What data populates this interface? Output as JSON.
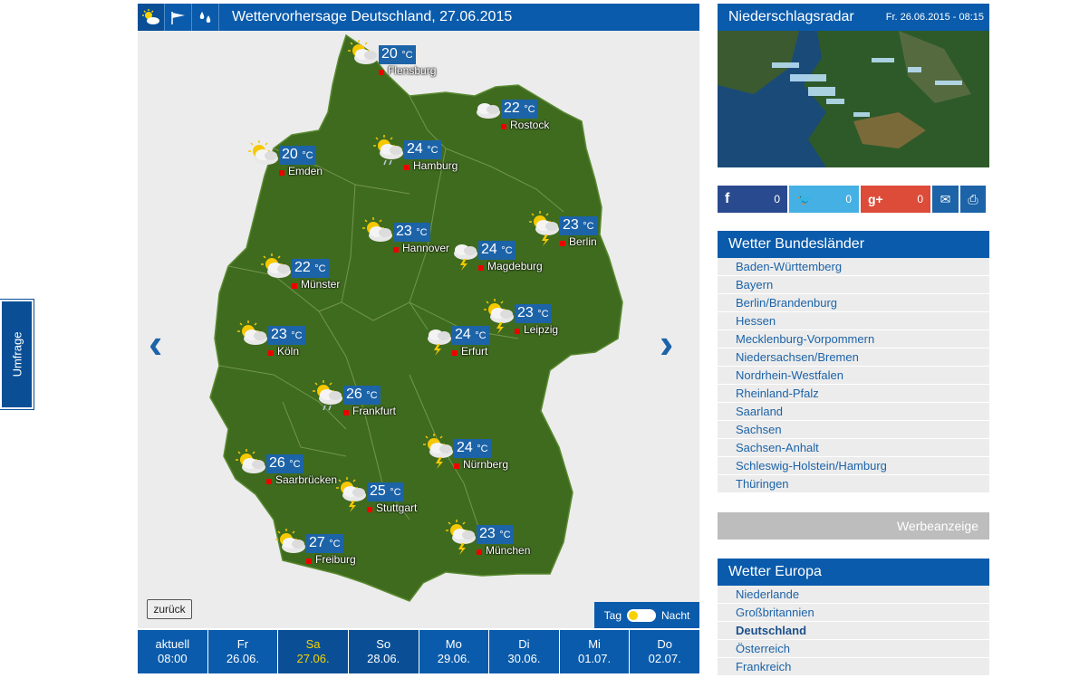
{
  "umfrage": {
    "label": "Umfrage"
  },
  "map": {
    "title": "Wettervorhersage Deutschland, 27.06.2015",
    "header_icons": [
      "sun-cloud-icon",
      "wind-icon",
      "rain-drops-icon"
    ],
    "unit": "°C",
    "cities": [
      {
        "name": "Flensburg",
        "temp": "20",
        "icon": "sun-cloud-icon"
      },
      {
        "name": "Rostock",
        "temp": "22",
        "icon": "cloud-icon"
      },
      {
        "name": "Hamburg",
        "temp": "24",
        "icon": "sun-cloud-rain-icon"
      },
      {
        "name": "Emden",
        "temp": "20",
        "icon": "sun-cloud-icon"
      },
      {
        "name": "Berlin",
        "temp": "23",
        "icon": "sun-cloud-thunder-icon"
      },
      {
        "name": "Hannover",
        "temp": "23",
        "icon": "sun-cloud-icon"
      },
      {
        "name": "Magdeburg",
        "temp": "24",
        "icon": "cloud-thunder-icon"
      },
      {
        "name": "Münster",
        "temp": "22",
        "icon": "sun-cloud-icon"
      },
      {
        "name": "Leipzig",
        "temp": "23",
        "icon": "sun-cloud-thunder-icon"
      },
      {
        "name": "Köln",
        "temp": "23",
        "icon": "sun-cloud-icon"
      },
      {
        "name": "Erfurt",
        "temp": "24",
        "icon": "cloud-thunder-icon"
      },
      {
        "name": "Frankfurt",
        "temp": "26",
        "icon": "sun-cloud-rain-icon"
      },
      {
        "name": "Nürnberg",
        "temp": "24",
        "icon": "sun-cloud-thunder-icon"
      },
      {
        "name": "Saarbrücken",
        "temp": "26",
        "icon": "sun-cloud-icon"
      },
      {
        "name": "Stuttgart",
        "temp": "25",
        "icon": "sun-cloud-thunder-icon"
      },
      {
        "name": "München",
        "temp": "23",
        "icon": "sun-cloud-thunder-icon"
      },
      {
        "name": "Freiburg",
        "temp": "27",
        "icon": "sun-cloud-icon"
      }
    ],
    "back_label": "zurück",
    "toggle": {
      "day": "Tag",
      "night": "Nacht"
    },
    "days": [
      {
        "day": "aktuell",
        "date": "08:00"
      },
      {
        "day": "Fr",
        "date": "26.06."
      },
      {
        "day": "Sa",
        "date": "27.06."
      },
      {
        "day": "So",
        "date": "28.06."
      },
      {
        "day": "Mo",
        "date": "29.06."
      },
      {
        "day": "Di",
        "date": "30.06."
      },
      {
        "day": "Mi",
        "date": "01.07."
      },
      {
        "day": "Do",
        "date": "02.07."
      }
    ],
    "colors": {
      "header": "#0a5bab",
      "land": "#3f6b1f",
      "selected_day_text": "#f6d300"
    }
  },
  "radar": {
    "title": "Niederschlagsradar",
    "date": "Fr. 26.06.2015 - 08:15"
  },
  "share": {
    "facebook_count": "0",
    "twitter_count": "0",
    "googleplus_count": "0",
    "colors": {
      "facebook": "#2a4a8f",
      "twitter": "#45b0e3",
      "googleplus": "#dd4b39",
      "mail": "#1c63a8",
      "print": "#1c63a8"
    }
  },
  "bundeslaender": {
    "title": "Wetter Bundesländer",
    "items": [
      "Baden-Württemberg",
      "Bayern",
      "Berlin/Brandenburg",
      "Hessen",
      "Mecklenburg-Vorpommern",
      "Niedersachsen/Bremen",
      "Nordrhein-Westfalen",
      "Rheinland-Pfalz",
      "Saarland",
      "Sachsen",
      "Sachsen-Anhalt",
      "Schleswig-Holstein/Hamburg",
      "Thüringen"
    ]
  },
  "ad": {
    "label": "Werbeanzeige"
  },
  "europa": {
    "title": "Wetter Europa",
    "items": [
      "Niederlande",
      "Großbritannien",
      "Deutschland",
      "Österreich",
      "Frankreich"
    ],
    "current": "Deutschland"
  }
}
